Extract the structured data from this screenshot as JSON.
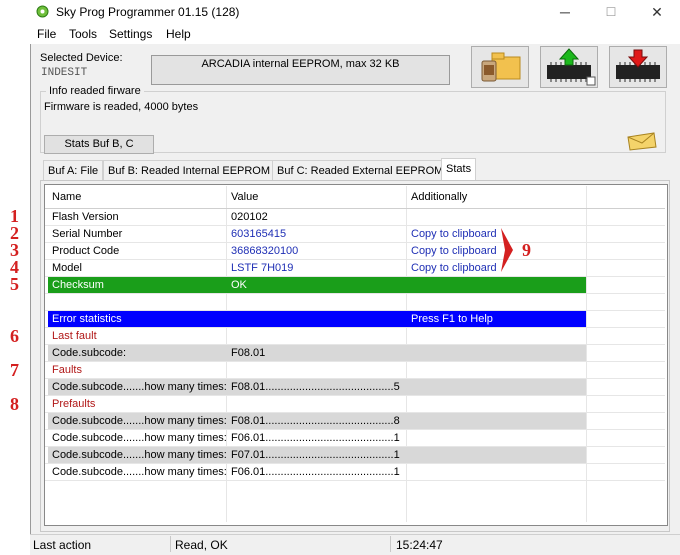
{
  "window": {
    "title": "Sky Prog Programmer  01.15 (128)",
    "controls": [
      "─",
      "☐",
      "✕"
    ]
  },
  "menu": [
    "File",
    "Tools",
    "Settings",
    "Help"
  ],
  "device": {
    "label": "Selected Device:",
    "vendor": "INDESIT",
    "name": "ARCADIA internal EEPROM, max 32 KB"
  },
  "info": {
    "title": "Info readed firware",
    "text": "Firmware is readed, 4000 bytes",
    "stats_button": "Stats Buf B, C"
  },
  "tabs": [
    "Buf A: File",
    "Buf B: Readed Internal EEPROM",
    "Buf C: Readed External EEPROM",
    "Stats"
  ],
  "grid": {
    "headers": [
      "Name",
      "Value",
      "Additionally"
    ],
    "rows": [
      {
        "name": "Flash Version",
        "value": "020102",
        "extra": "",
        "style": "plain"
      },
      {
        "name": "Serial Number",
        "value": "603165415",
        "extra": "Copy to clipboard",
        "style": "link"
      },
      {
        "name": "Product Code",
        "value": "36868320100",
        "extra": "Copy to clipboard",
        "style": "link"
      },
      {
        "name": "Model",
        "value": "LSTF 7H019",
        "extra": "Copy to clipboard",
        "style": "link"
      },
      {
        "name": "Checksum",
        "value": "OK",
        "extra": "",
        "style": "green"
      },
      {
        "name": "",
        "value": "",
        "extra": "",
        "style": "plain"
      },
      {
        "name": "Error statistics",
        "value": "",
        "extra": "Press F1 to Help",
        "style": "blue"
      },
      {
        "name": "Last fault",
        "value": "",
        "extra": "",
        "style": "red"
      },
      {
        "name": "Code.subcode:",
        "value": "F08.01",
        "extra": "",
        "style": "gray"
      },
      {
        "name": "Faults",
        "value": "",
        "extra": "",
        "style": "red"
      },
      {
        "name": "Code.subcode.......how many times:",
        "value": "F08.01..........................................5",
        "extra": "",
        "style": "gray"
      },
      {
        "name": "Prefaults",
        "value": "",
        "extra": "",
        "style": "red"
      },
      {
        "name": "Code.subcode.......how many times:",
        "value": "F08.01..........................................8",
        "extra": "",
        "style": "gray"
      },
      {
        "name": "Code.subcode.......how many times:",
        "value": "F06.01..........................................1",
        "extra": "",
        "style": "plain"
      },
      {
        "name": "Code.subcode.......how many times:",
        "value": "F07.01..........................................1",
        "extra": "",
        "style": "gray"
      },
      {
        "name": "Code.subcode.......how many times:",
        "value": "F06.01..........................................1",
        "extra": "",
        "style": "plain"
      }
    ]
  },
  "annotations": [
    "1",
    "2",
    "3",
    "4",
    "5",
    "6",
    "7",
    "8",
    "9"
  ],
  "status": {
    "label": "Last action",
    "result": "Read, OK",
    "time": "15:24:47"
  },
  "colors": {
    "checksum_green": "#1a9e1a",
    "error_blue": "#0000ff",
    "link_blue": "#1f2fb5",
    "annotation_red": "#d42020"
  }
}
